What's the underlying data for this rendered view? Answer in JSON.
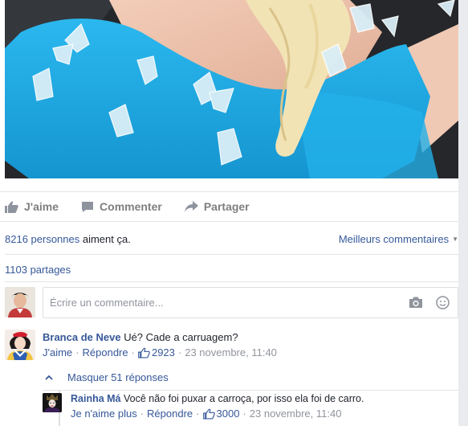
{
  "post": {
    "actions": [
      {
        "label": "J'aime",
        "icon": "thumbs-up-icon"
      },
      {
        "label": "Commenter",
        "icon": "comment-bubble-icon"
      },
      {
        "label": "Partager",
        "icon": "share-arrow-icon"
      }
    ],
    "likes_count": "8216 personnes",
    "likes_suffix": " aiment ça.",
    "sort_label": "Meilleurs commentaires",
    "shares_count": "1103 partages"
  },
  "composer": {
    "placeholder": "Écrire un commentaire...",
    "icons": [
      "camera-icon",
      "emoji-icon"
    ]
  },
  "comments": [
    {
      "author": "Branca de Neve",
      "text": "Ué? Cade a carruagem?",
      "like_label": "J'aime",
      "reply_label": "Répondre",
      "like_count": "2923",
      "time": "23 novembre, 11:40"
    }
  ],
  "replies_toggle": "Masquer 51 réponses",
  "replies": [
    {
      "author": "Rainha Má",
      "text": "Você não foi puxar a carroça, por isso ela foi de carro.",
      "like_label": "Je n'aime plus",
      "reply_label": "Répondre",
      "like_count": "3000",
      "time": "23 novembre, 11:40"
    }
  ],
  "colors": {
    "link": "#365899",
    "muted": "#90949c",
    "action_gray": "#7f7f7f",
    "dress_blue": "#1aa6e0",
    "border": "#e5e5e5"
  }
}
